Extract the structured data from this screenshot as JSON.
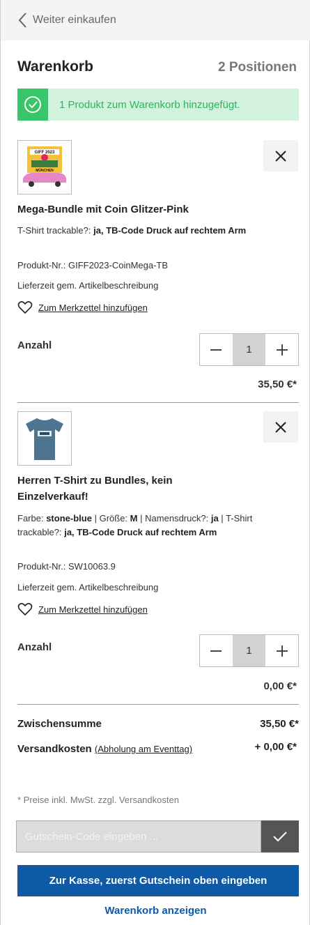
{
  "header": {
    "back_label": "Weiter einkaufen"
  },
  "cart": {
    "title": "Warenkorb",
    "count": "2 Positionen"
  },
  "alert": {
    "message": "1 Produkt zum Warenkorb hinzugefügt.",
    "color": "#37c66a"
  },
  "items": [
    {
      "name": "Mega-Bundle mit Coin Glitzer-Pink",
      "option_label": "T-Shirt trackable?:",
      "option_value": "ja, TB-Code Druck auf rechtem Arm",
      "sku_label": "Produkt-Nr.:",
      "sku": "GIFF2023-CoinMega-TB",
      "delivery": "Lieferzeit gem. Artikelbeschreibung",
      "wishlist": "Zum Merkzettel hinzufügen",
      "qty_label": "Anzahl",
      "qty": "1",
      "price": "35,50 €*",
      "thumb_text_top": "GIFF 2023",
      "thumb_text_bottom": "MÜNCHEN"
    },
    {
      "name": "Herren T-Shirt zu Bundles, kein Einzelverkauf!",
      "color_label": "Farbe:",
      "color_value": "stone-blue",
      "size_label": "Größe:",
      "size_value": "M",
      "print_label": "Namensdruck?:",
      "print_value": "ja",
      "option_label": "T-Shirt trackable?:",
      "option_value": "ja, TB-Code Druck auf rechtem Arm",
      "sku_label": "Produkt-Nr.:",
      "sku": "SW10063.9",
      "delivery": "Lieferzeit gem. Artikelbeschreibung",
      "wishlist": "Zum Merkzettel hinzufügen",
      "qty_label": "Anzahl",
      "qty": "1",
      "price": "0,00 €*"
    }
  ],
  "summary": {
    "subtotal_label": "Zwischensumme",
    "subtotal": "35,50 €*",
    "shipping_label": "Versandkosten",
    "shipping_link": "(Abholung am Eventtag)",
    "shipping": "+ 0,00 €*",
    "note": "* Preise inkl. MwSt. zzgl. Versandkosten"
  },
  "voucher": {
    "placeholder": "Gutschein-Code eingeben ..."
  },
  "actions": {
    "checkout": "Zur Kasse, zuerst Gutschein oben eingeben",
    "view_cart": "Warenkorb anzeigen"
  }
}
